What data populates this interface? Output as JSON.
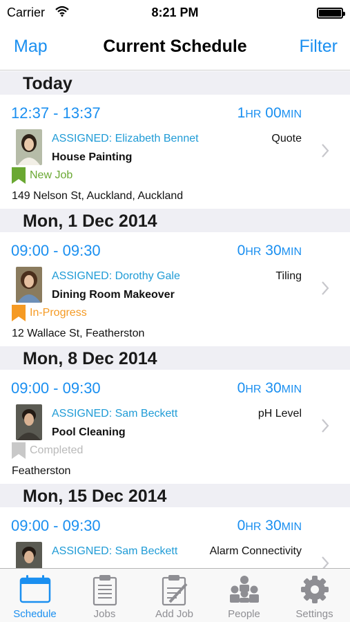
{
  "status_bar": {
    "carrier": "Carrier",
    "time": "8:21 PM"
  },
  "nav": {
    "left": "Map",
    "title": "Current Schedule",
    "right": "Filter"
  },
  "colors": {
    "accent": "#1a8ff0",
    "new_job": "#6aa832",
    "in_progress": "#f59a23",
    "completed": "#c8c8c8"
  },
  "sections": [
    {
      "header": "Today",
      "job": {
        "time": "12:37 - 13:37",
        "dur_h": "1",
        "dur_h_unit": "HR",
        "dur_m": " 00",
        "dur_m_unit": "MIN",
        "assigned": "ASSIGNED: Elizabeth Bennet",
        "category": "Quote",
        "title": "House Painting",
        "status": "New Job",
        "address": "149 Nelson St, Auckland, Auckland"
      }
    },
    {
      "header": "Mon, 1 Dec 2014",
      "job": {
        "time": "09:00 - 09:30",
        "dur_h": "0",
        "dur_h_unit": "HR",
        "dur_m": " 30",
        "dur_m_unit": "MIN",
        "assigned": "ASSIGNED: Dorothy Gale",
        "category": "Tiling",
        "title": "Dining Room Makeover",
        "status": "In-Progress",
        "address": "12 Wallace St, Featherston"
      }
    },
    {
      "header": "Mon, 8 Dec 2014",
      "job": {
        "time": "09:00 - 09:30",
        "dur_h": "0",
        "dur_h_unit": "HR",
        "dur_m": " 30",
        "dur_m_unit": "MIN",
        "assigned": "ASSIGNED: Sam Beckett",
        "category": "pH Level",
        "title": "Pool Cleaning",
        "status": "Completed",
        "address": "Featherston"
      }
    },
    {
      "header": "Mon, 15 Dec 2014",
      "job": {
        "time": "09:00 - 09:30",
        "dur_h": "0",
        "dur_h_unit": "HR",
        "dur_m": " 30",
        "dur_m_unit": "MIN",
        "assigned": "ASSIGNED: Sam Beckett",
        "category": "Alarm Connectivity",
        "title": "",
        "status": "",
        "address": ""
      }
    }
  ],
  "tabs": [
    {
      "label": "Schedule",
      "icon": "calendar-icon",
      "active": true
    },
    {
      "label": "Jobs",
      "icon": "clipboard-icon"
    },
    {
      "label": "Add Job",
      "icon": "add-job-icon"
    },
    {
      "label": "People",
      "icon": "people-icon"
    },
    {
      "label": "Settings",
      "icon": "gear-icon"
    }
  ]
}
